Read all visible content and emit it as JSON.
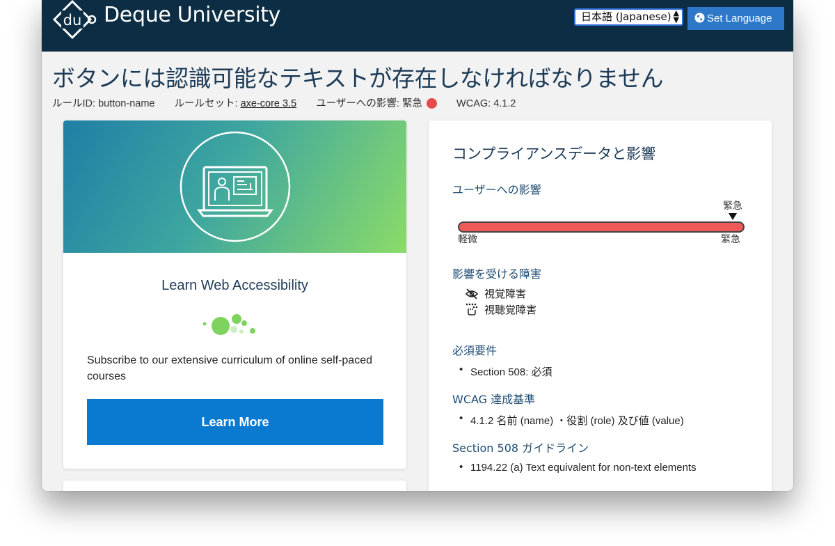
{
  "header": {
    "brand": "Deque University",
    "logo_text": "du",
    "language_select": "日本語 (Japanese)",
    "set_language_label": "Set Language"
  },
  "page": {
    "title": "ボタンには認識可能なテキストが存在しなければなりません",
    "meta": {
      "rule_id_label": "ルールID:",
      "rule_id": "button-name",
      "ruleset_label": "ルールセット:",
      "ruleset": "axe-core 3.5",
      "impact_label": "ユーザーへの影響:",
      "impact": "緊急",
      "wcag_label": "WCAG:",
      "wcag": "4.1.2"
    }
  },
  "promo": {
    "title": "Learn Web Accessibility",
    "text": "Subscribe to our extensive curriculum of online self-paced courses",
    "button": "Learn More"
  },
  "compliance": {
    "title": "コンプライアンスデータと影響",
    "impact_heading": "ユーザーへの影響",
    "impact_value": "緊急",
    "impact_level": 1.0,
    "scale_min": "軽微",
    "scale_max": "緊急",
    "disabilities_heading": "影響を受ける障害",
    "disabilities": [
      "視覚障害",
      "視聴覚障害"
    ],
    "requirements_heading": "必須要件",
    "requirements": [
      "Section 508: 必須"
    ],
    "wcag_heading": "WCAG 達成基準",
    "wcag_items": [
      "4.1.2 名前 (name) ・役割 (role) 及び値 (value)"
    ],
    "section508_heading": "Section 508 ガイドライン",
    "section508_items": [
      "1194.22 (a) Text equivalent for non-text elements"
    ]
  },
  "colors": {
    "header_bg": "#0c2d43",
    "accent_blue": "#0a7ad1",
    "impact_red": "#e64b4b",
    "heading_blue": "#1e4b71"
  }
}
